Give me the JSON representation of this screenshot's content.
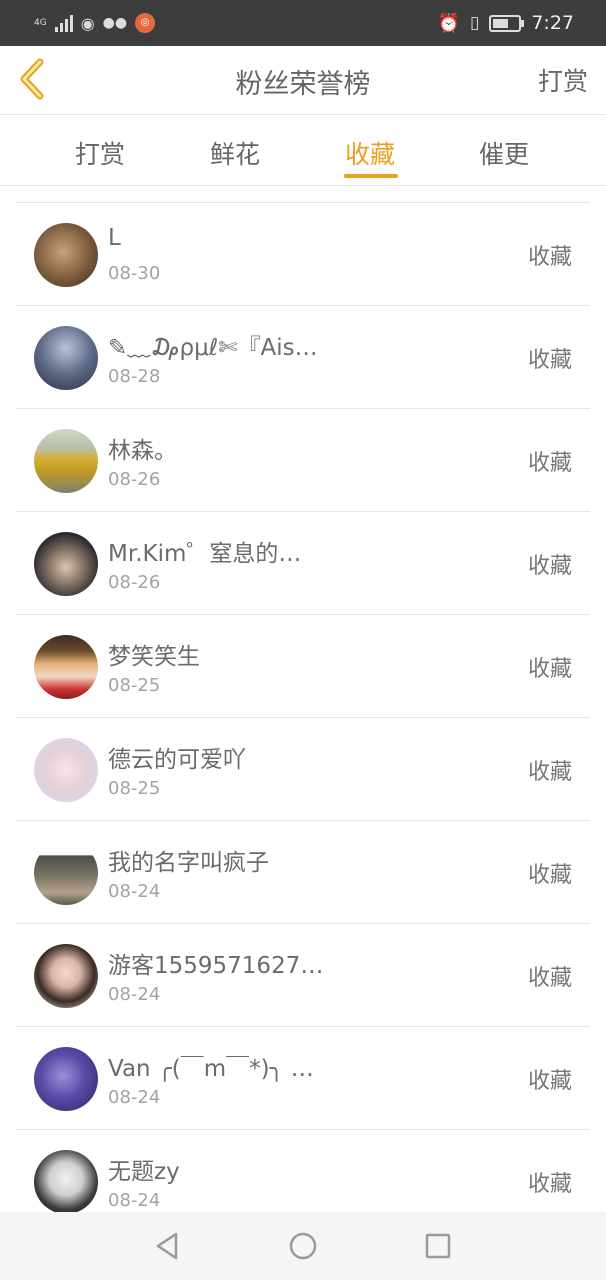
{
  "status_bar": {
    "network": "4G",
    "time": "7:27"
  },
  "header": {
    "title": "粉丝荣誉榜",
    "right_action": "打赏"
  },
  "tabs": [
    {
      "label": "打赏",
      "active": false
    },
    {
      "label": "鲜花",
      "active": false
    },
    {
      "label": "收藏",
      "active": true
    },
    {
      "label": "催更",
      "active": false
    }
  ],
  "accent_color": "#eaa01f",
  "list": [
    {
      "name": "L",
      "date": "08-30",
      "action": "收藏"
    },
    {
      "name": "✎﹏₯ρμℓ✄『Ais…",
      "date": "08-28",
      "action": "收藏"
    },
    {
      "name": "林森。",
      "date": "08-26",
      "action": "收藏"
    },
    {
      "name": "Mr.Kim゜窒息的…",
      "date": "08-26",
      "action": "收藏"
    },
    {
      "name": "梦笑笑生",
      "date": "08-25",
      "action": "收藏"
    },
    {
      "name": "德云的可爱吖",
      "date": "08-25",
      "action": "收藏"
    },
    {
      "name": "我的名字叫疯子",
      "date": "08-24",
      "action": "收藏"
    },
    {
      "name": "游客1559571627…",
      "date": "08-24",
      "action": "收藏"
    },
    {
      "name": "Van ╭(￣m￣*)╮ …",
      "date": "08-24",
      "action": "收藏"
    },
    {
      "name": "无题zy",
      "date": "08-24",
      "action": "收藏"
    }
  ]
}
